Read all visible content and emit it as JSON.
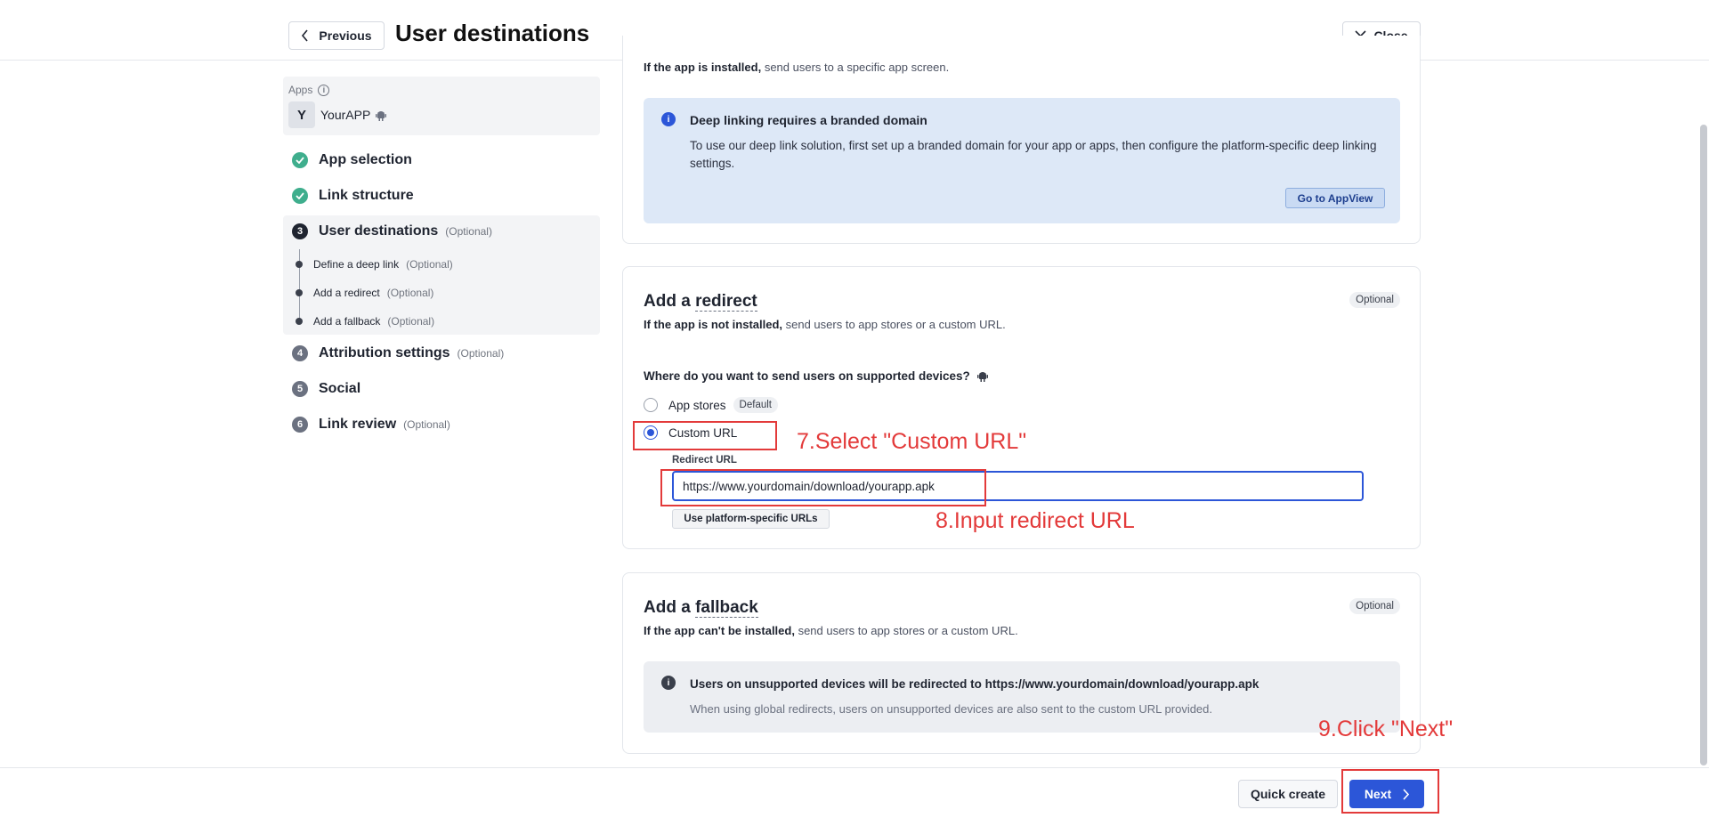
{
  "header": {
    "previous_label": "Previous",
    "title": "User destinations",
    "close_label": "Close"
  },
  "sidebar": {
    "apps_label": "Apps",
    "app_initial": "Y",
    "app_name": "YourAPP",
    "steps": [
      {
        "label": "App selection",
        "status": "done",
        "optional": ""
      },
      {
        "label": "Link structure",
        "status": "done",
        "optional": ""
      },
      {
        "number": "3",
        "label": "User destinations",
        "status": "active",
        "optional": "(Optional)"
      },
      {
        "number": "4",
        "label": "Attribution settings",
        "status": "pending",
        "optional": "(Optional)"
      },
      {
        "number": "5",
        "label": "Social",
        "status": "pending",
        "optional": ""
      },
      {
        "number": "6",
        "label": "Link review",
        "status": "pending",
        "optional": "(Optional)"
      }
    ],
    "substeps": [
      {
        "label": "Define a deep link",
        "optional": "(Optional)"
      },
      {
        "label": "Add a redirect",
        "optional": "(Optional)"
      },
      {
        "label": "Add a fallback",
        "optional": "(Optional)"
      }
    ]
  },
  "deeplink_card": {
    "installed_bold": "If the app is installed,",
    "installed_rest": " send users to a specific app screen.",
    "alert_title": "Deep linking requires a branded domain",
    "alert_body": "To use our deep link solution, first set up a branded domain for your app or apps, then configure the platform-specific deep linking settings.",
    "alert_button": "Go to AppView"
  },
  "redirect_card": {
    "title_prefix": "Add a ",
    "title_term": "redirect",
    "badge": "Optional",
    "desc_bold": "If the app is not installed,",
    "desc_rest": " send users to app stores or a custom URL.",
    "question": "Where do you want to send users on supported devices?",
    "option_app_stores": "App stores",
    "option_default_badge": "Default",
    "option_custom_url": "Custom URL",
    "selected_option": "Custom URL",
    "redirect_url_label": "Redirect URL",
    "redirect_url_value": "https://www.yourdomain/download/yourapp.apk",
    "platform_button": "Use platform-specific URLs"
  },
  "fallback_card": {
    "title_prefix": "Add a ",
    "title_term": "fallback",
    "badge": "Optional",
    "desc_bold": "If the app can't be installed,",
    "desc_rest": " send users to app stores or a custom URL.",
    "alert_title": "Users on unsupported devices will be redirected to https://www.yourdomain/download/yourapp.apk",
    "alert_body": "When using global redirects, users on unsupported devices are also sent to the custom URL provided."
  },
  "footer": {
    "quick_create_label": "Quick create",
    "next_label": "Next"
  },
  "annotations": {
    "step7": "7.Select \"Custom URL\"",
    "step8": "8.Input redirect URL",
    "step9": "9.Click \"Next\"",
    "color": "#e33a3a"
  },
  "colors": {
    "accent": "#2c56d8",
    "success": "#3fae8d",
    "info_bg": "#dde8f7"
  }
}
